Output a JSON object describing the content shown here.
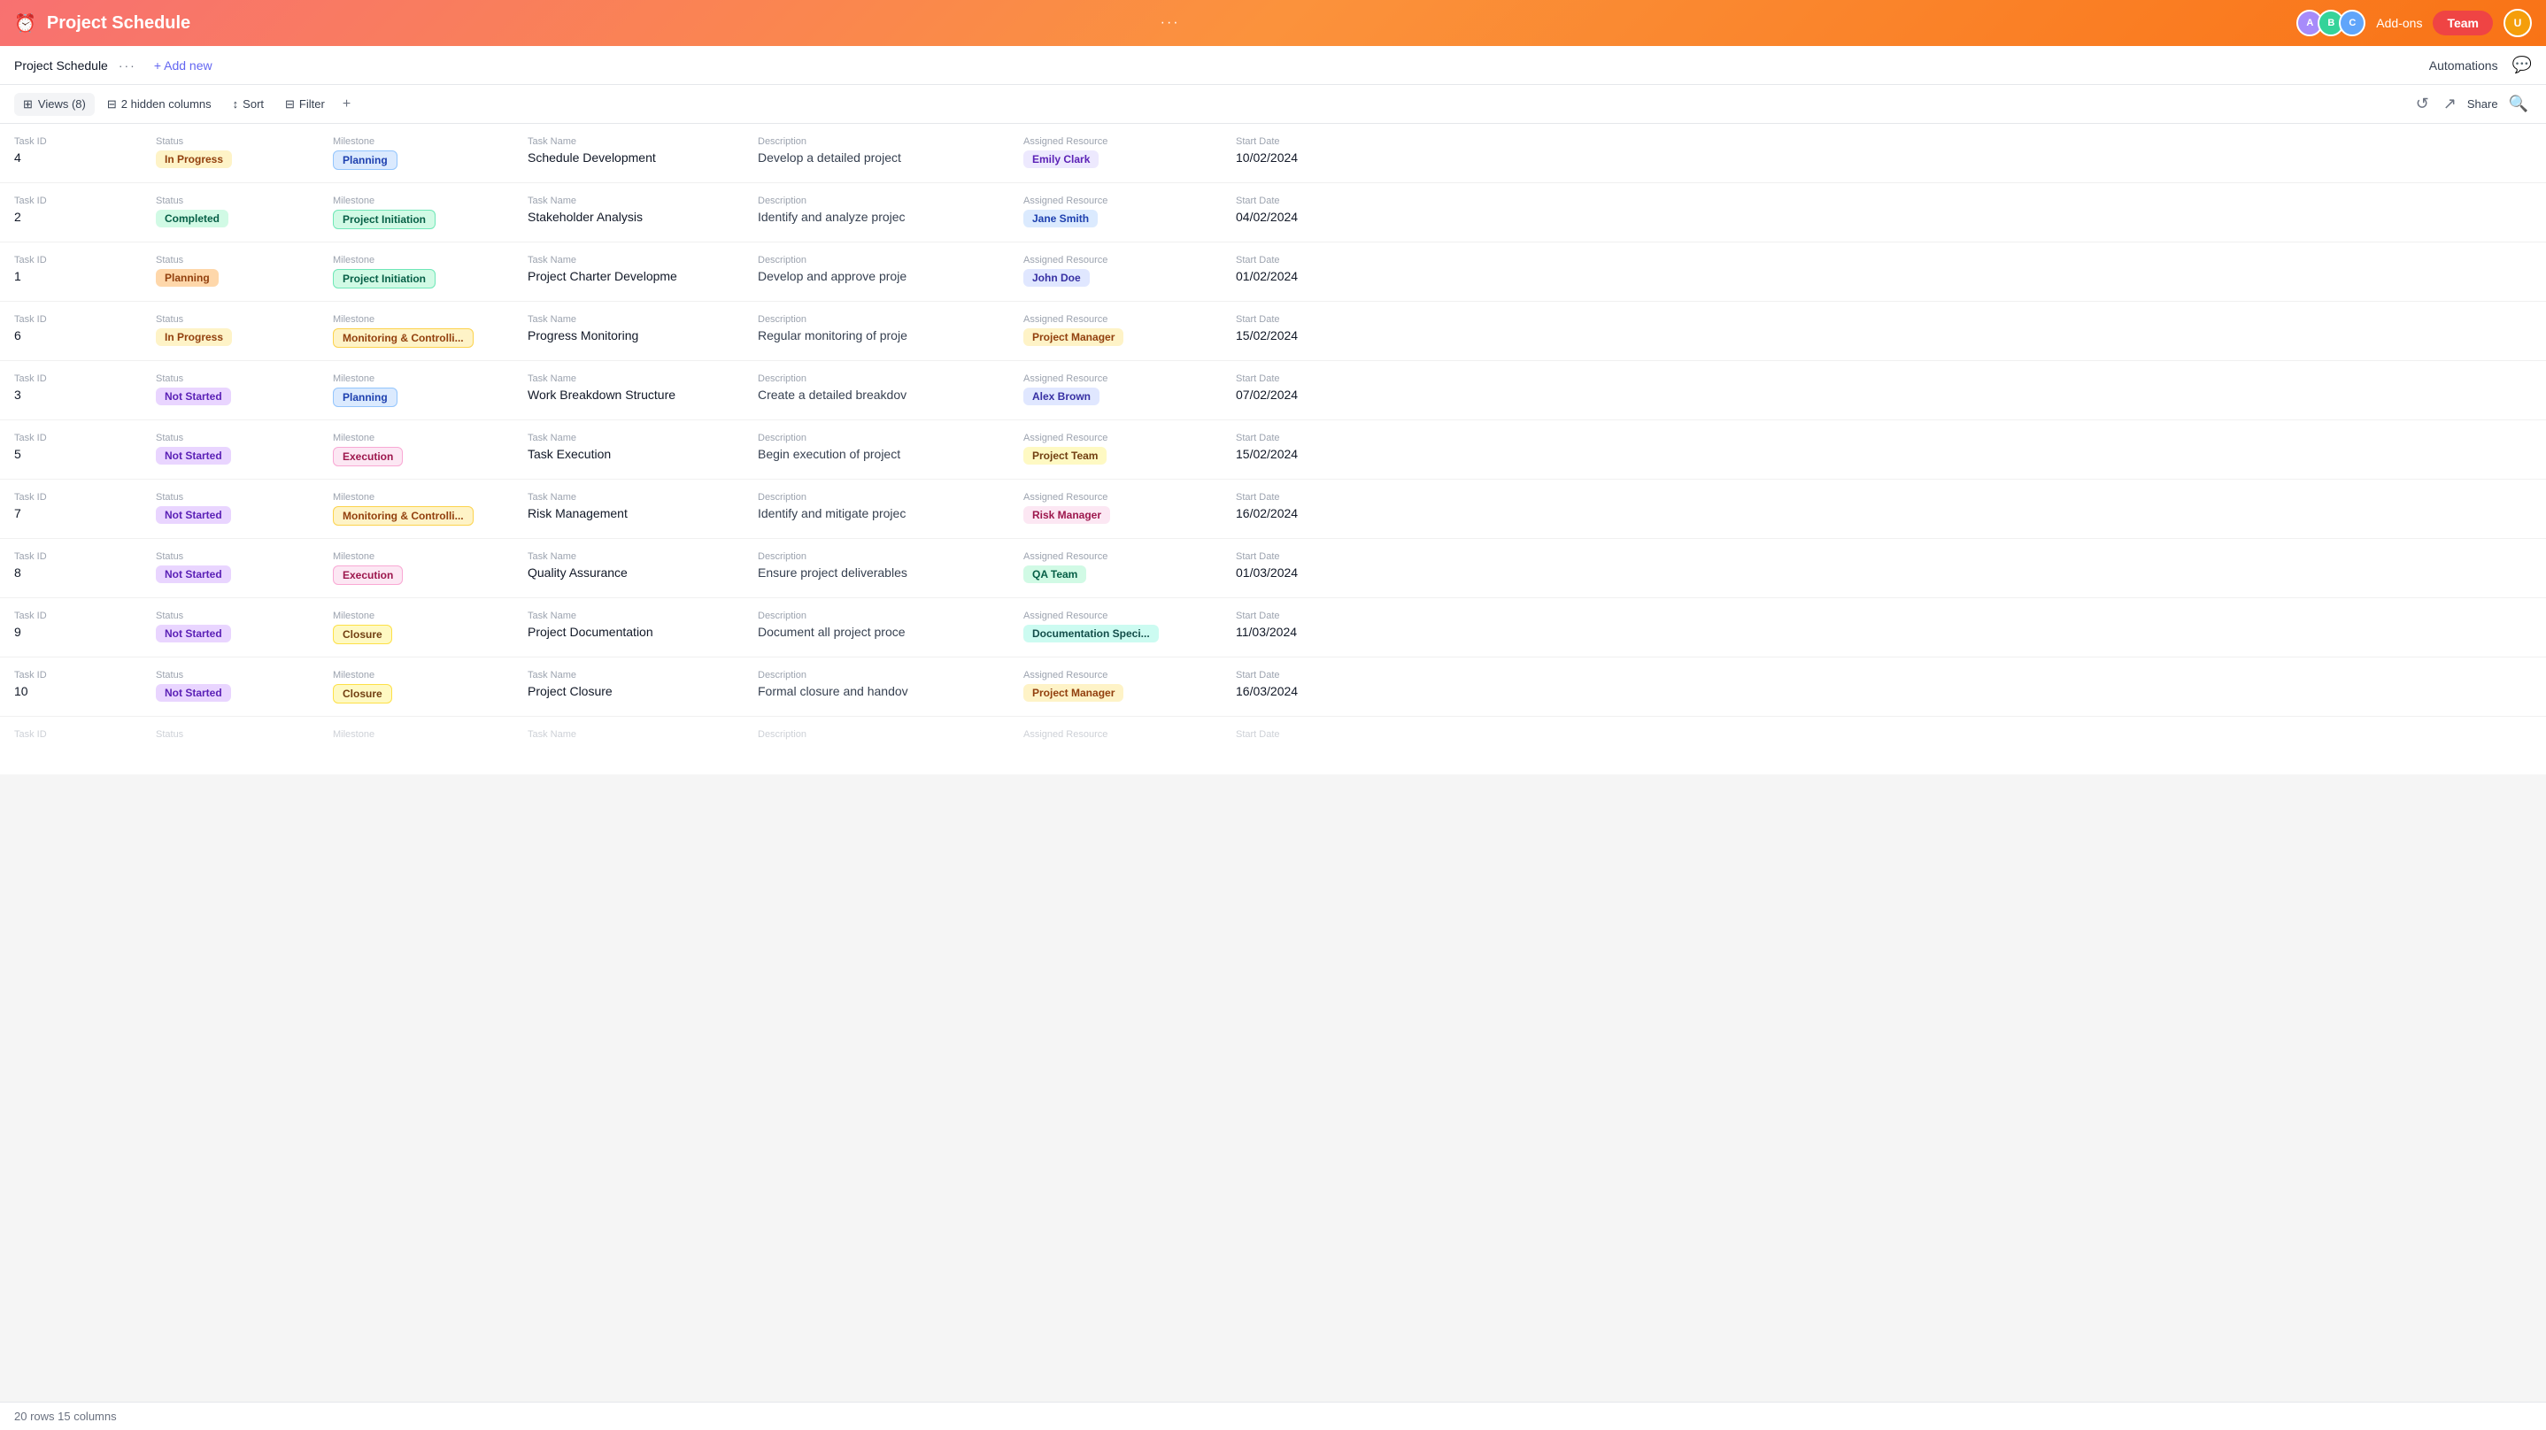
{
  "header": {
    "title": "Project Schedule",
    "dots": "···",
    "addons": "Add-ons",
    "team": "Team"
  },
  "secondBar": {
    "tabLabel": "Project Schedule",
    "tabDots": "···",
    "addNew": "+ Add new",
    "automations": "Automations"
  },
  "toolbar": {
    "views": "Views (8)",
    "hiddenCols": "2 hidden columns",
    "sort": "Sort",
    "filter": "Filter",
    "plus": "+",
    "share": "Share"
  },
  "columns": [
    "Task ID",
    "Status",
    "Milestone",
    "Task Name",
    "Description",
    "Assigned Resource",
    "Start Date"
  ],
  "rows": [
    {
      "taskId": "4",
      "status": "In Progress",
      "statusClass": "badge-in-progress",
      "milestone": "Planning",
      "milestoneClass": "m-planning",
      "taskName": "Schedule Development",
      "description": "Develop a detailed project",
      "resource": "Emily Clark",
      "resourceClass": "r-emily",
      "startDate": "10/02/2024"
    },
    {
      "taskId": "2",
      "status": "Completed",
      "statusClass": "badge-completed",
      "milestone": "Project Initiation",
      "milestoneClass": "m-initiation",
      "taskName": "Stakeholder Analysis",
      "description": "Identify and analyze projec",
      "resource": "Jane Smith",
      "resourceClass": "r-jane",
      "startDate": "04/02/2024"
    },
    {
      "taskId": "1",
      "status": "Planning",
      "statusClass": "badge-planning-status",
      "milestone": "Project Initiation",
      "milestoneClass": "m-initiation",
      "taskName": "Project Charter Developme",
      "description": "Develop and approve proje",
      "resource": "John Doe",
      "resourceClass": "r-john",
      "startDate": "01/02/2024"
    },
    {
      "taskId": "6",
      "status": "In Progress",
      "statusClass": "badge-in-progress",
      "milestone": "Monitoring & Controlli...",
      "milestoneClass": "m-monitoring",
      "taskName": "Progress Monitoring",
      "description": "Regular monitoring of proje",
      "resource": "Project Manager",
      "resourceClass": "r-pm",
      "startDate": "15/02/2024"
    },
    {
      "taskId": "3",
      "status": "Not Started",
      "statusClass": "badge-not-started",
      "milestone": "Planning",
      "milestoneClass": "m-planning",
      "taskName": "Work Breakdown Structure",
      "description": "Create a detailed breakdov",
      "resource": "Alex Brown",
      "resourceClass": "r-alex",
      "startDate": "07/02/2024"
    },
    {
      "taskId": "5",
      "status": "Not Started",
      "statusClass": "badge-not-started",
      "milestone": "Execution",
      "milestoneClass": "m-execution",
      "taskName": "Task Execution",
      "description": "Begin execution of project",
      "resource": "Project Team",
      "resourceClass": "r-team",
      "startDate": "15/02/2024"
    },
    {
      "taskId": "7",
      "status": "Not Started",
      "statusClass": "badge-not-started",
      "milestone": "Monitoring & Controlli...",
      "milestoneClass": "m-monitoring",
      "taskName": "Risk Management",
      "description": "Identify and mitigate projec",
      "resource": "Risk Manager",
      "resourceClass": "r-risk",
      "startDate": "16/02/2024"
    },
    {
      "taskId": "8",
      "status": "Not Started",
      "statusClass": "badge-not-started",
      "milestone": "Execution",
      "milestoneClass": "m-execution",
      "taskName": "Quality Assurance",
      "description": "Ensure project deliverables",
      "resource": "QA Team",
      "resourceClass": "r-qa",
      "startDate": "01/03/2024"
    },
    {
      "taskId": "9",
      "status": "Not Started",
      "statusClass": "badge-not-started",
      "milestone": "Closure",
      "milestoneClass": "m-closure",
      "taskName": "Project Documentation",
      "description": "Document all project proce",
      "resource": "Documentation Speci...",
      "resourceClass": "r-doc",
      "startDate": "11/03/2024"
    },
    {
      "taskId": "10",
      "status": "Not Started",
      "statusClass": "badge-not-started",
      "milestone": "Closure",
      "milestoneClass": "m-closure",
      "taskName": "Project Closure",
      "description": "Formal closure and handov",
      "resource": "Project Manager",
      "resourceClass": "r-pm",
      "startDate": "16/03/2024"
    }
  ],
  "footer": {
    "text": "20 rows  15 columns"
  }
}
